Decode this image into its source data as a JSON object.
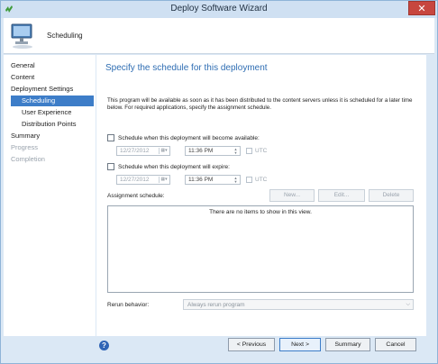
{
  "window": {
    "title": "Deploy Software Wizard",
    "close_glyph": "✕"
  },
  "header": {
    "title": "Scheduling",
    "icon": "computer-monitor-icon"
  },
  "sidebar": {
    "items": [
      {
        "label": "General",
        "state": "normal",
        "indent": false
      },
      {
        "label": "Content",
        "state": "normal",
        "indent": false
      },
      {
        "label": "Deployment Settings",
        "state": "normal",
        "indent": false
      },
      {
        "label": "Scheduling",
        "state": "selected",
        "indent": true
      },
      {
        "label": "User Experience",
        "state": "normal",
        "indent": true
      },
      {
        "label": "Distribution Points",
        "state": "normal",
        "indent": true
      },
      {
        "label": "Summary",
        "state": "normal",
        "indent": false
      },
      {
        "label": "Progress",
        "state": "disabled",
        "indent": false
      },
      {
        "label": "Completion",
        "state": "disabled",
        "indent": false
      }
    ]
  },
  "main": {
    "heading": "Specify the schedule for this deployment",
    "description": "This program will be available as soon as it has been distributed to the content servers unless it is scheduled for a later time below. For required applications, specify the assignment schedule.",
    "available": {
      "label": "Schedule when this deployment will become available:",
      "checked": false,
      "date": "12/27/2012",
      "time": "11:36 PM",
      "utc_label": "UTC"
    },
    "expire": {
      "label": "Schedule when this deployment will expire:",
      "checked": false,
      "date": "12/27/2012",
      "time": "11:36 PM",
      "utc_label": "UTC"
    },
    "assignment": {
      "label": "Assignment schedule:",
      "new_label": "New...",
      "edit_label": "Edit...",
      "delete_label": "Delete",
      "empty_text": "There are no items to show in this view."
    },
    "rerun": {
      "label": "Rerun behavior:",
      "value": "Always rerun program"
    }
  },
  "footer": {
    "help_glyph": "?",
    "previous_label": "< Previous",
    "next_label": "Next >",
    "summary_label": "Summary",
    "cancel_label": "Cancel"
  },
  "colors": {
    "accent": "#3d7dc8",
    "heading": "#2e6db3",
    "chrome": "#dbe8f5",
    "close": "#c7463f"
  }
}
